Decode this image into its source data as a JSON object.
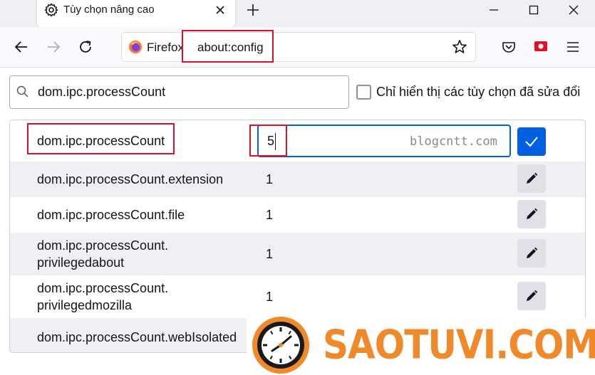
{
  "window": {
    "tab_title": "Tùy chọn nâng cao"
  },
  "toolbar": {
    "identity_label": "Firefox",
    "url": "about:config"
  },
  "search": {
    "value": "dom.ipc.processCount",
    "show_modified_label": "Chỉ hiển thị các tùy chọn đã sửa đổi"
  },
  "prefs": {
    "editing": {
      "name": "dom.ipc.processCount",
      "value": "5"
    },
    "rows": [
      {
        "name": "dom.ipc.processCount.extension",
        "value": "1"
      },
      {
        "name": "dom.ipc.processCount.file",
        "value": "1"
      },
      {
        "name_line1": "dom.ipc.processCount.",
        "name_line2": "privilegedabout",
        "value": "1"
      },
      {
        "name_line1": "dom.ipc.processCount.",
        "name_line2": "privilegedmozilla",
        "value": "1"
      },
      {
        "name": "dom.ipc.processCount.webIsolated"
      }
    ]
  },
  "watermarks": {
    "small": "blogcntt.com",
    "banner": "SAOTUVI.COM"
  },
  "colors": {
    "accent": "#0061e0",
    "highlight": "#e0102a",
    "banner": "#f0892a"
  }
}
